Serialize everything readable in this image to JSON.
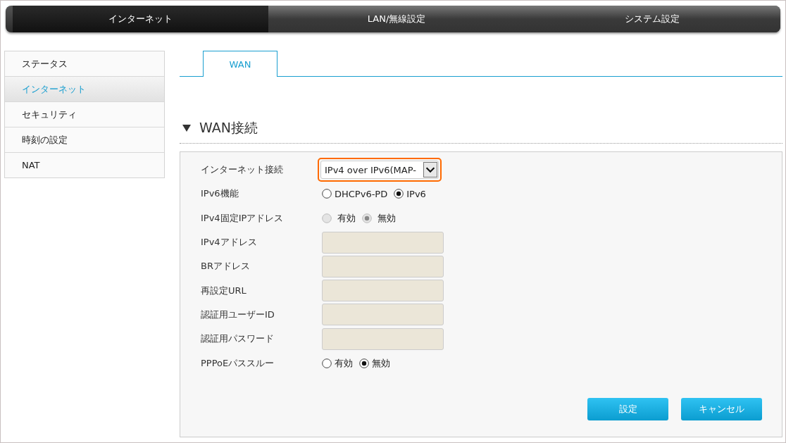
{
  "top_nav": [
    {
      "label": "インターネット",
      "selected": true
    },
    {
      "label": "LAN/無線設定",
      "selected": false
    },
    {
      "label": "システム設定",
      "selected": false
    }
  ],
  "sidebar": {
    "items": [
      {
        "label": "ステータス",
        "selected": false
      },
      {
        "label": "インターネット",
        "selected": true
      },
      {
        "label": "セキュリティ",
        "selected": false
      },
      {
        "label": "時刻の設定",
        "selected": false
      },
      {
        "label": "NAT",
        "selected": false
      }
    ]
  },
  "tabs": [
    {
      "label": "WAN",
      "selected": true
    }
  ],
  "section": {
    "title": "WAN接続",
    "expanded": true
  },
  "form": [
    {
      "kind": "select",
      "label": "インターネット接続",
      "value": "IPv4 over IPv6(MAP-",
      "focused": true
    },
    {
      "kind": "radio",
      "label": "IPv6機能",
      "options": [
        {
          "label": "DHCPv6-PD",
          "selected": false,
          "disabled": false
        },
        {
          "label": "IPv6",
          "selected": true,
          "disabled": false
        }
      ]
    },
    {
      "kind": "radio",
      "label": "IPv4固定IPアドレス",
      "options": [
        {
          "label": "有効",
          "selected": false,
          "disabled": true
        },
        {
          "label": "無効",
          "selected": true,
          "disabled": true
        }
      ]
    },
    {
      "kind": "text",
      "label": "IPv4アドレス",
      "disabled": true
    },
    {
      "kind": "text",
      "label": "BRアドレス",
      "disabled": true
    },
    {
      "kind": "text",
      "label": "再設定URL",
      "disabled": true
    },
    {
      "kind": "text",
      "label": "認証用ユーザーID",
      "disabled": true
    },
    {
      "kind": "text",
      "label": "認証用パスワード",
      "disabled": true
    },
    {
      "kind": "radio",
      "label": "PPPoEパススルー",
      "options": [
        {
          "label": "有効",
          "selected": false,
          "disabled": false
        },
        {
          "label": "無効",
          "selected": true,
          "disabled": false
        }
      ]
    }
  ],
  "buttons": [
    "設定",
    "キャンセル"
  ]
}
